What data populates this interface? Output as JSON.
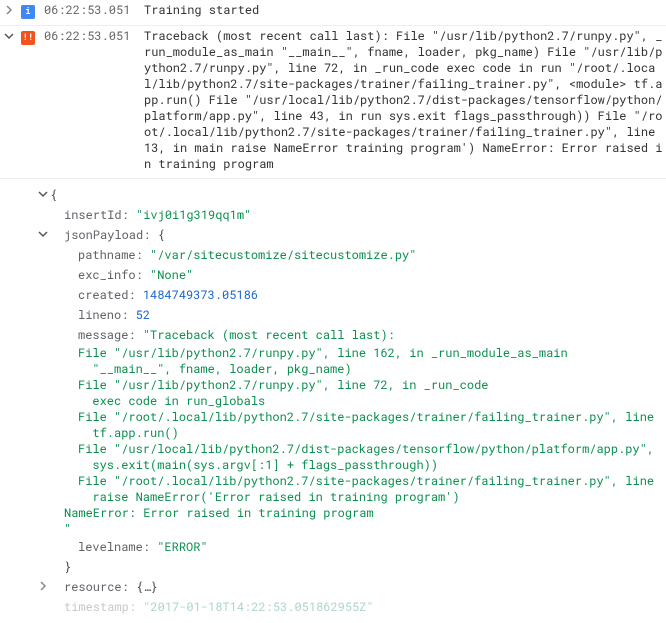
{
  "rows": [
    {
      "severity": "info",
      "timestamp": "06:22:53.051",
      "message": "Training started"
    },
    {
      "severity": "error",
      "timestamp": "06:22:53.051",
      "message": "Traceback (most recent call last): File \"/usr/lib/python2.7/runpy.py\", _run_module_as_main \"__main__\", fname, loader, pkg_name) File \"/usr/lib/python2.7/runpy.py\", line 72, in _run_code exec code in run \"/root/.local/lib/python2.7/site-packages/trainer/failing_trainer.py\", <module> tf.app.run() File \"/usr/local/lib/python2.7/dist-packages/tensorflow/python/platform/app.py\", line 43, in run sys.exit flags_passthrough)) File \"/root/.local/lib/python2.7/site-packages/trainer/failing_trainer.py\", line 13, in main raise NameError training program') NameError: Error raised in training program"
    }
  ],
  "detail": {
    "insertId": "ivj0i1g319qq1m",
    "jsonPayload": {
      "pathname": "/var/sitecustomize/sitecustomize.py",
      "exc_info": "None",
      "created": "1484749373.05186",
      "lineno": "52",
      "message_head": "Traceback (most recent call last):",
      "message_lines": [
        "File \"/usr/lib/python2.7/runpy.py\", line 162, in _run_module_as_main",
        "  \"__main__\", fname, loader, pkg_name)",
        "File \"/usr/lib/python2.7/runpy.py\", line 72, in _run_code",
        "  exec code in run_globals",
        "File \"/root/.local/lib/python2.7/site-packages/trainer/failing_trainer.py\", line",
        "  tf.app.run()",
        "File \"/usr/local/lib/python2.7/dist-packages/tensorflow/python/platform/app.py\",",
        "  sys.exit(main(sys.argv[:1] + flags_passthrough))",
        "File \"/root/.local/lib/python2.7/site-packages/trainer/failing_trainer.py\", line",
        "  raise NameError('Error raised in training program')",
        "NameError: Error raised in training program",
        "\""
      ],
      "levelname": "ERROR"
    },
    "resource_collapsed": "{…}",
    "timestamp_tail": "\"2017-01-18T14:22:53.051862955Z\""
  },
  "labels": {
    "info_badge": "i",
    "error_badge": "!!",
    "insertId_key": "insertId:",
    "jsonPayload_key": "jsonPayload:",
    "pathname_key": "pathname:",
    "exc_info_key": "exc_info:",
    "created_key": "created:",
    "lineno_key": "lineno:",
    "message_key": "message:",
    "levelname_key": "levelname:",
    "resource_key": "resource:",
    "timestamp_key": "timestamp:",
    "brace_open": "{",
    "brace_close": "}"
  }
}
